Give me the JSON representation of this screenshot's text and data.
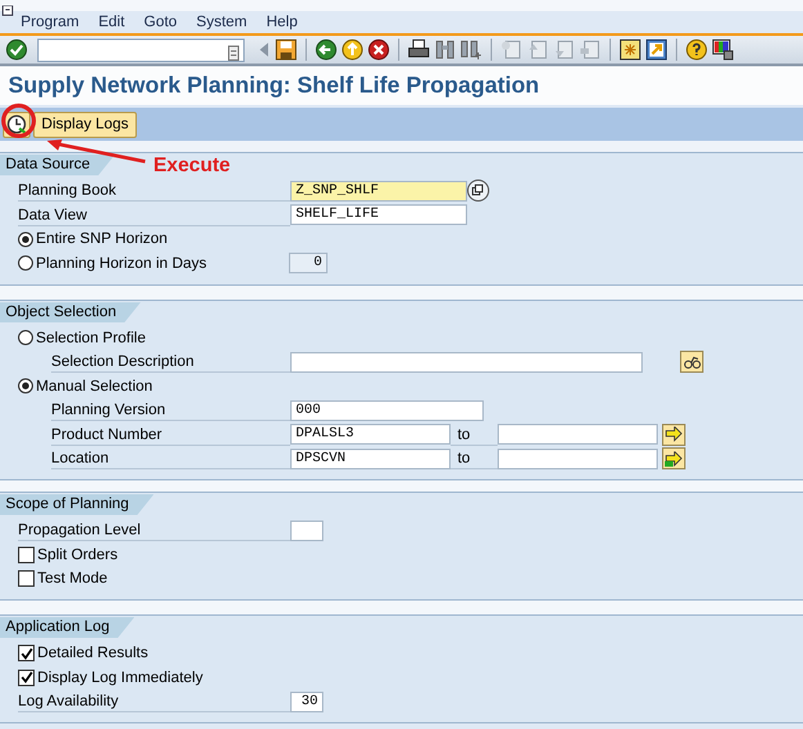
{
  "menu": [
    "Program",
    "Edit",
    "Goto",
    "System",
    "Help"
  ],
  "title": "Supply Network Planning: Shelf Life Propagation",
  "app_toolbar": {
    "buttons": [
      {
        "kind": "execute"
      },
      {
        "kind": "text",
        "label": "Display Logs"
      }
    ]
  },
  "annotation": {
    "label": "Execute"
  },
  "sections": [
    {
      "title": "Data Source",
      "rows": [
        {
          "kind": "field",
          "label": "Planning Book",
          "value": "Z_SNP_SHLF",
          "highlighted": true,
          "disabled": false,
          "value_help": true
        },
        {
          "kind": "field",
          "label": "Data View",
          "value": "SHELF_LIFE",
          "highlighted": false,
          "disabled": false
        },
        {
          "kind": "radio",
          "label": "Entire SNP Horizon",
          "selected": true
        },
        {
          "kind": "radio",
          "label": "Planning Horizon in Days",
          "selected": false,
          "trailing": {
            "value": "0",
            "disabled": true
          }
        }
      ]
    },
    {
      "title": "Object Selection",
      "rows": [
        {
          "kind": "radio",
          "label": "Selection Profile",
          "selected": false,
          "children": [
            {
              "kind": "field",
              "label": "Selection Description",
              "highlighted": false,
              "disabled": false,
              "search_help": true
            }
          ]
        },
        {
          "kind": "radio",
          "label": "Manual Selection",
          "selected": true,
          "children": [
            {
              "kind": "field",
              "label": "Planning Version",
              "value": "000",
              "highlighted": false,
              "disabled": false
            },
            {
              "kind": "range",
              "label": "Product Number",
              "value": "DPALSL3",
              "to_label": "to"
            },
            {
              "kind": "range",
              "label": "Location",
              "value": "DPSCVN",
              "to_label": "to"
            }
          ]
        }
      ]
    },
    {
      "title": "Scope of Planning",
      "rows": [
        {
          "kind": "field",
          "label": "Propagation Level",
          "highlighted": false,
          "disabled": false
        },
        {
          "kind": "checkbox",
          "label": "Split Orders",
          "checked": false
        },
        {
          "kind": "checkbox",
          "label": "Test Mode",
          "checked": false
        }
      ]
    },
    {
      "title": "Application Log",
      "rows": [
        {
          "kind": "checkbox",
          "label": "Detailed Results",
          "checked": true
        },
        {
          "kind": "checkbox",
          "label": "Display Log Immediately",
          "checked": true
        },
        {
          "kind": "field",
          "label": "Log Availability",
          "value": "30",
          "highlighted": false,
          "disabled": false
        }
      ]
    }
  ]
}
